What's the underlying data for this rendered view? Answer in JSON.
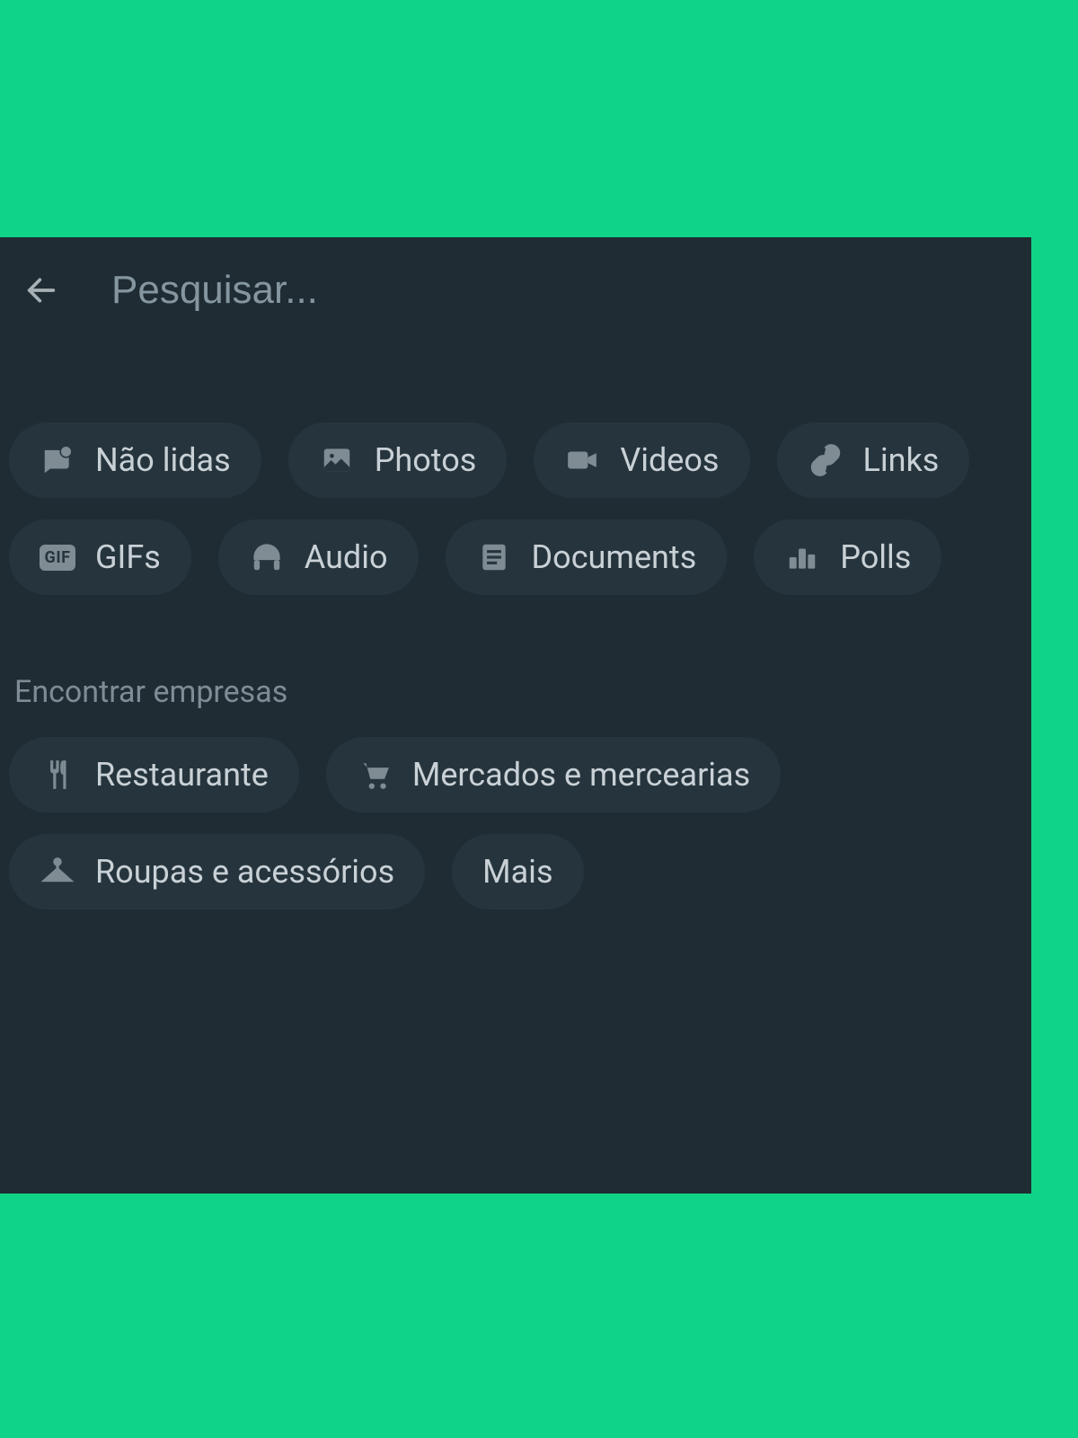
{
  "search": {
    "placeholder": "Pesquisar..."
  },
  "filters": {
    "unread": "Não lidas",
    "photos": "Photos",
    "videos": "Videos",
    "links": "Links",
    "gifs": "GIFs",
    "audio": "Audio",
    "documents": "Documents",
    "polls": "Polls"
  },
  "businesses": {
    "section_label": "Encontrar empresas",
    "restaurant": "Restaurante",
    "groceries": "Mercados e mercearias",
    "clothing": "Roupas e acessórios",
    "more": "Mais"
  }
}
